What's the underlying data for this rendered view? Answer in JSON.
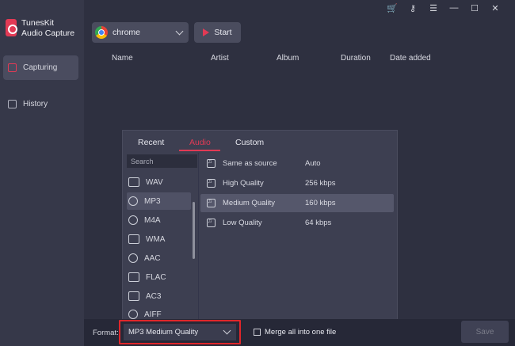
{
  "app": {
    "name_line1": "TunesKit",
    "name_line2": "Audio Capture"
  },
  "sidebar": {
    "items": [
      {
        "label": "Capturing",
        "icon": "capture-icon",
        "active": true
      },
      {
        "label": "History",
        "icon": "history-icon",
        "active": false
      }
    ]
  },
  "titlebar": {
    "icons": [
      "cart-icon",
      "key-icon",
      "menu-icon",
      "minimize-icon",
      "maximize-icon",
      "close-icon"
    ],
    "cart_color": "#e8902c"
  },
  "toolbar": {
    "source": "chrome",
    "start_label": "Start"
  },
  "table": {
    "columns": [
      "Name",
      "Artist",
      "Album",
      "Duration",
      "Date added"
    ]
  },
  "format_popup": {
    "tabs": [
      "Recent",
      "Audio",
      "Custom"
    ],
    "active_tab": "Audio",
    "search_placeholder": "Search",
    "formats": [
      "WAV",
      "MP3",
      "M4A",
      "WMA",
      "AAC",
      "FLAC",
      "AC3",
      "AIFF"
    ],
    "selected_format": "MP3",
    "qualities": [
      {
        "name": "Same as source",
        "value": "Auto"
      },
      {
        "name": "High Quality",
        "value": "256 kbps"
      },
      {
        "name": "Medium Quality",
        "value": "160 kbps"
      },
      {
        "name": "Low Quality",
        "value": "64 kbps"
      }
    ],
    "selected_quality": "Medium Quality"
  },
  "footer": {
    "format_label": "Format:",
    "format_value": "MP3 Medium Quality",
    "merge_label": "Merge all into one file",
    "merge_checked": false,
    "save_label": "Save"
  },
  "colors": {
    "accent": "#e23a55",
    "highlight_border": "#e0262a"
  }
}
